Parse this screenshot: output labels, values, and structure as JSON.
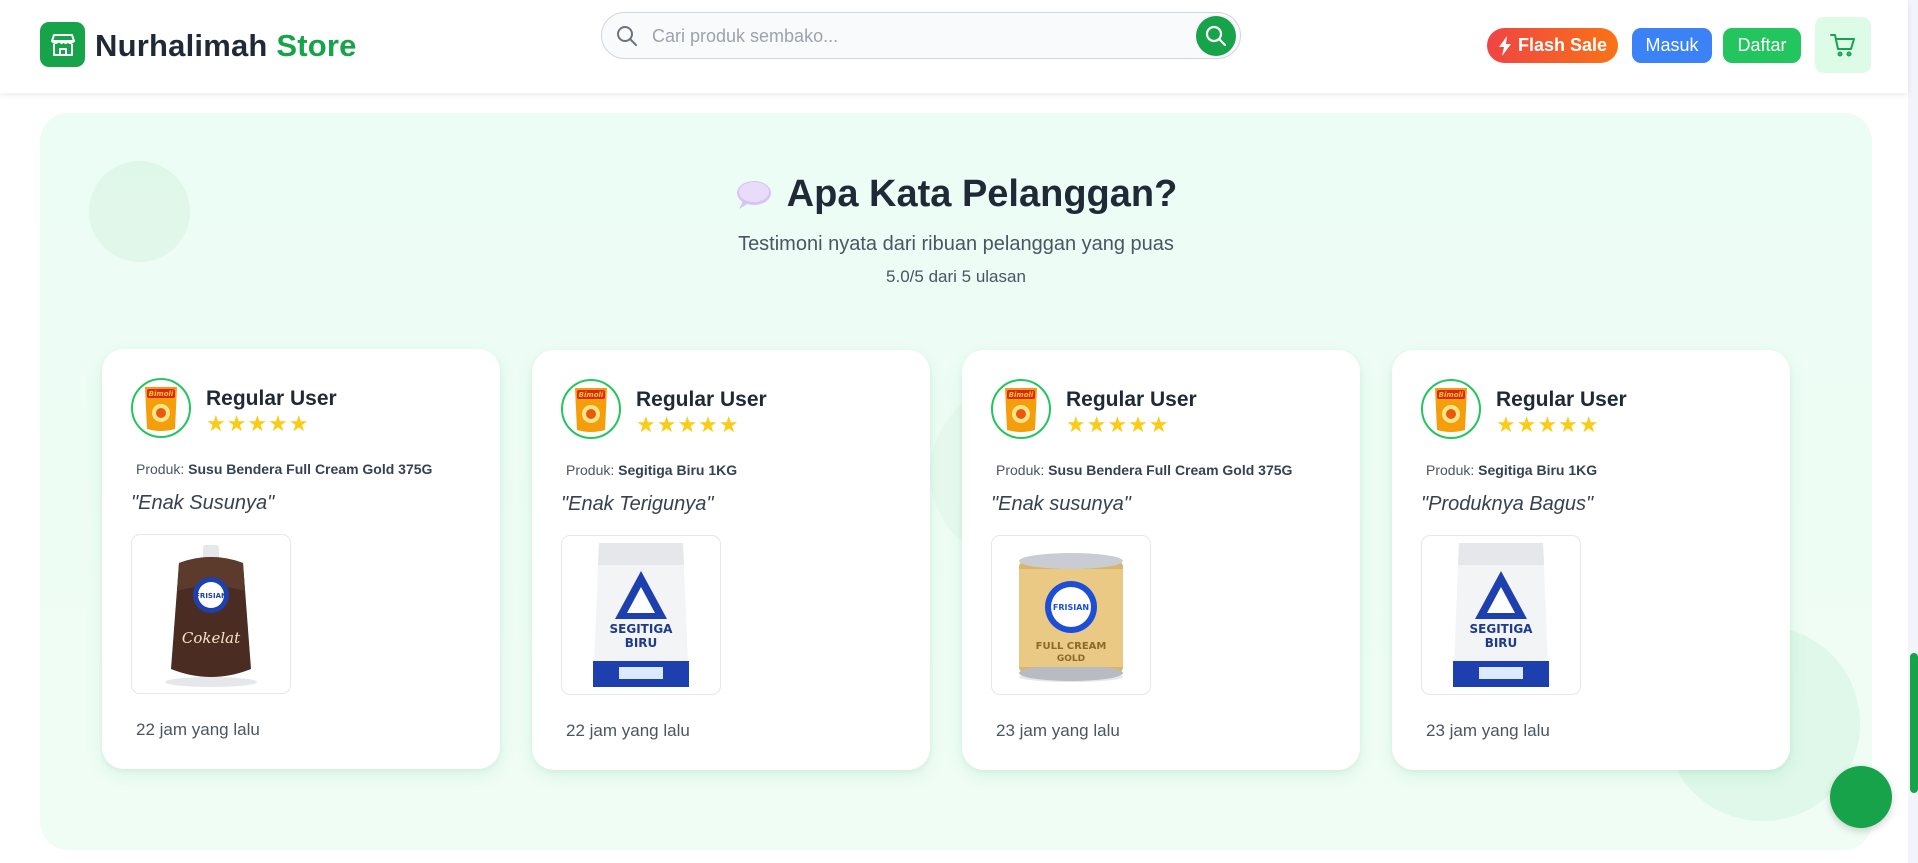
{
  "header": {
    "brand_main": "Nurhalimah",
    "brand_accent": "Store",
    "search_placeholder": "Cari produk sembako...",
    "flash_sale_label": "Flash Sale",
    "login_label": "Masuk",
    "register_label": "Daftar"
  },
  "testimonials": {
    "title": "Apa Kata Pelanggan?",
    "subtitle": "Testimoni nyata dari ribuan pelanggan yang puas",
    "rating_summary": "5.0/5 dari 5 ulasan",
    "product_prefix": "Produk:",
    "items": [
      {
        "user": "Regular User",
        "stars": "★★★★★",
        "rating": 5,
        "product": "Susu Bendera Full Cream Gold 375G",
        "quote": "\"Enak Susunya\"",
        "time": "22 jam yang lalu",
        "image": "chocolate-milk-pouch"
      },
      {
        "user": "Regular User",
        "stars": "★★★★★",
        "rating": 5,
        "product": "Segitiga Biru 1KG",
        "quote": "\"Enak Terigunya\"",
        "time": "22 jam yang lalu",
        "image": "flour-bag"
      },
      {
        "user": "Regular User",
        "stars": "★★★★★",
        "rating": 5,
        "product": "Susu Bendera Full Cream Gold 375G",
        "quote": "\"Enak susunya\"",
        "time": "23 jam yang lalu",
        "image": "milk-can"
      },
      {
        "user": "Regular User",
        "stars": "★★★★★",
        "rating": 5,
        "product": "Segitiga Biru 1KG",
        "quote": "\"Produknya Bagus\"",
        "time": "23 jam yang lalu",
        "image": "flour-bag"
      }
    ]
  },
  "colors": {
    "brand_green": "#16a34a",
    "flash_red": "#ef4444",
    "flash_orange": "#f97316",
    "login_blue": "#3b82f6",
    "register_green": "#22c55e",
    "star_yellow": "#facc15",
    "section_bg": "#ecfdf5"
  }
}
